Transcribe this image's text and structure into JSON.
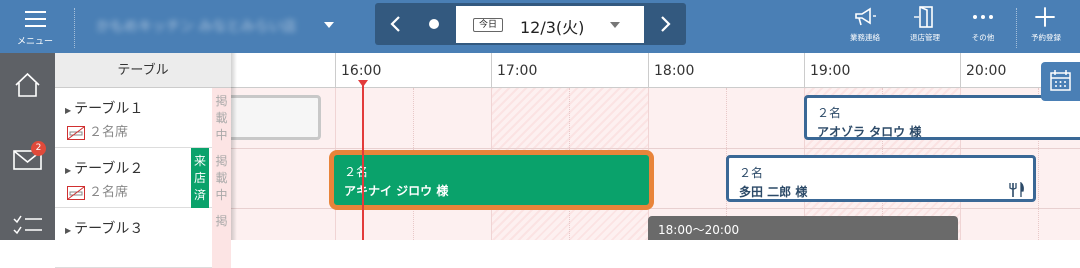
{
  "header": {
    "menu_label": "メニュー",
    "store_name": "かもめキッチン みなとみらい店",
    "today_label": "今日",
    "date": "12/3(火)",
    "tools": [
      {
        "label": "業務連絡",
        "icon": "megaphone-icon"
      },
      {
        "label": "退店管理",
        "icon": "exit-door-icon"
      },
      {
        "label": "その他",
        "icon": "more-dots-icon"
      },
      {
        "label": "予約登録",
        "icon": "plus-icon"
      }
    ]
  },
  "sidebar": {
    "items": [
      {
        "icon": "home-icon"
      },
      {
        "icon": "mail-icon",
        "badge": "2"
      },
      {
        "icon": "checklist-icon"
      }
    ]
  },
  "table_column": {
    "header": "テーブル"
  },
  "tables": [
    {
      "name": "テーブル１",
      "seats": "２名席",
      "posted": "掲載中",
      "visited": ""
    },
    {
      "name": "テーブル２",
      "seats": "２名席",
      "posted": "掲載中",
      "visited": "来店済"
    },
    {
      "name": "テーブル３",
      "seats": "",
      "posted": "掲",
      "visited": ""
    }
  ],
  "timeline": {
    "hours": [
      "16:00",
      "17:00",
      "18:00",
      "19:00",
      "20:00"
    ]
  },
  "reservations": [
    {
      "count": "２名",
      "name": "アオゾラ タロウ 様",
      "state": "reserved"
    },
    {
      "count": "２名",
      "name": "アキナイ ジロウ 様",
      "state": "seated"
    },
    {
      "count": "２名",
      "name": "多田 二郎 様",
      "state": "reserved-dining"
    },
    {
      "time": "18:00～20:00",
      "state": "blocked"
    }
  ],
  "colors": {
    "header_bg": "#4a7fb5",
    "date_nav_bg": "#33597f",
    "sidebar_bg": "#5e6166",
    "seated_fill": "#0aa26b",
    "seated_border": "#e8843a",
    "reserved_border": "#3a6896",
    "now_line": "#e23b3b"
  }
}
